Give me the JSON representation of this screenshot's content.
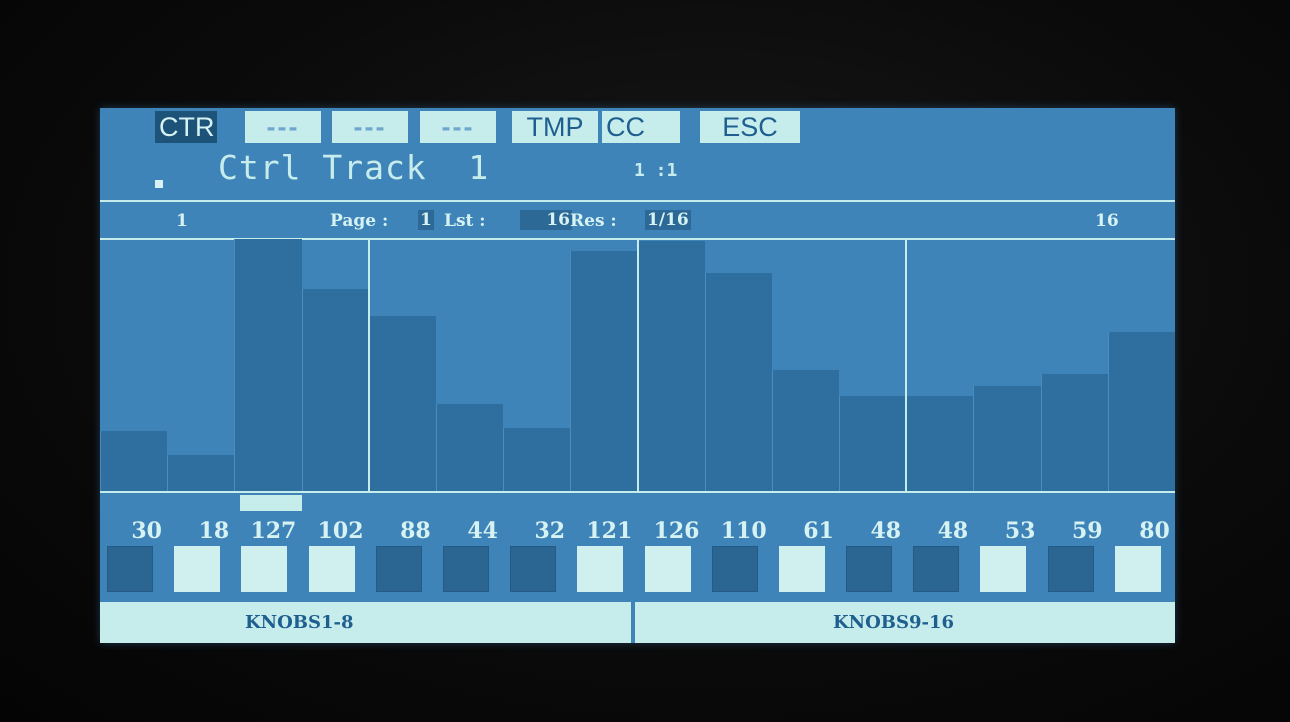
{
  "tabs": [
    {
      "label": "CTR",
      "active": true
    },
    {
      "label": "---",
      "active": false
    },
    {
      "label": "---",
      "active": false
    },
    {
      "label": "---",
      "active": false
    },
    {
      "label": "TMP",
      "active": false
    },
    {
      "label": "CC",
      "active": false
    },
    {
      "label": "ESC",
      "active": false
    }
  ],
  "track": {
    "title": "Ctrl Track  1",
    "position": "1 :1"
  },
  "info": {
    "first_step": "1",
    "page_label": "Page :",
    "page_value": "1",
    "length_label": "Lst :",
    "length_value": "16",
    "res_label": "Res :",
    "res_value": "1/16",
    "last_step": "16"
  },
  "steps": [
    30,
    18,
    127,
    102,
    88,
    44,
    32,
    121,
    126,
    110,
    61,
    48,
    48,
    53,
    59,
    80
  ],
  "step_labels": [
    "30",
    "18",
    "127",
    "102",
    "88",
    "44",
    "32",
    "121",
    "126",
    "110",
    "61",
    "48",
    "48",
    "53",
    "59",
    "80"
  ],
  "current_step": 3,
  "knob_states": [
    false,
    true,
    true,
    true,
    false,
    false,
    false,
    true,
    true,
    false,
    true,
    false,
    false,
    true,
    false,
    true
  ],
  "banks": {
    "left": "KNOBS1-8",
    "right": "KNOBS9-16"
  },
  "colors": {
    "screen": "#3f84b8",
    "bar": "#2f6f9f",
    "highlight": "#c6ecec",
    "text_dark": "#1f5f8f"
  }
}
